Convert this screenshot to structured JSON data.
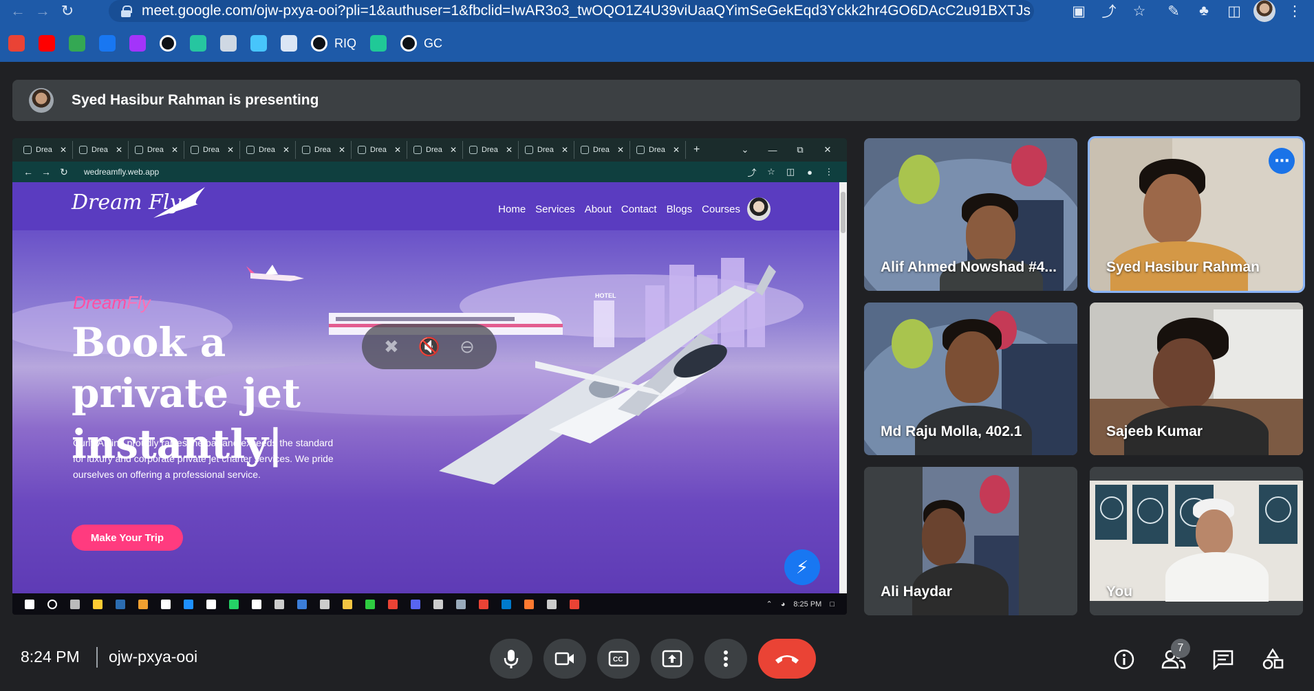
{
  "browser": {
    "url": "meet.google.com/ojw-pxya-ooi?pli=1&authuser=1&fbclid=IwAR3o3_twOQO1Z4U39viUaaQYimSeGekEqd3Yckk2hr4GO6DAcC2u91BXTJs",
    "bookmarks": [
      {
        "label": "",
        "icon": "gmail-icon",
        "color": "#ea4335"
      },
      {
        "label": "",
        "icon": "youtube-icon",
        "color": "#ff0000"
      },
      {
        "label": "",
        "icon": "maps-icon",
        "color": "#34a853"
      },
      {
        "label": "",
        "icon": "facebook-icon",
        "color": "#1877f2"
      },
      {
        "label": "",
        "icon": "messenger-icon",
        "color": "#a334fa"
      },
      {
        "label": "",
        "icon": "github-icon",
        "color": "#ffffff"
      },
      {
        "label": "",
        "icon": "replit-icon",
        "color": "#26c6a0"
      },
      {
        "label": "",
        "icon": "layers-icon",
        "color": "#cfd8e3"
      },
      {
        "label": "",
        "icon": "flutter-icon",
        "color": "#47c5fb"
      },
      {
        "label": "",
        "icon": "bike-icon",
        "color": "#dbe6f5"
      },
      {
        "label": "RIQ",
        "icon": "github-icon",
        "color": "#ffffff"
      },
      {
        "label": "",
        "icon": "diamond-icon",
        "color": "#20c997"
      },
      {
        "label": "GC",
        "icon": "github-icon",
        "color": "#ffffff"
      }
    ]
  },
  "banner": {
    "text": "Syed Hasibur Rahman is presenting"
  },
  "shared_screen": {
    "inner_tab_label": "Drea",
    "inner_tab_count": 12,
    "inner_url": "wedreamfly.web.app",
    "site": {
      "logo": "Dream Fly",
      "nav": [
        "Home",
        "Services",
        "About",
        "Contact",
        "Blogs",
        "Courses"
      ],
      "brand_dream": "Dream",
      "brand_fly": "Fly",
      "headline": "Book a private jet instantly|",
      "description": "Curly Airline proudly raises the bar and exceeds the standard for luxury and corporate private jet charter services. We pride ourselves on offering a professional service.",
      "cta": "Make Your Trip",
      "hotel_sign": "HOTEL"
    },
    "taskbar_time": "8:25 PM"
  },
  "participants": [
    {
      "name": "Alif Ahmed Nowshad #4..."
    },
    {
      "name": "Syed Hasibur Rahman",
      "active": true
    },
    {
      "name": "Md Raju Molla, 402.1"
    },
    {
      "name": "Sajeeb Kumar"
    },
    {
      "name": "Ali Haydar"
    },
    {
      "name": "You"
    }
  ],
  "bottom": {
    "time": "8:24 PM",
    "meeting_code": "ojw-pxya-ooi",
    "people_count": "7"
  },
  "colors": {
    "meet_bg": "#202124",
    "control_bg": "#3c4043",
    "end_call": "#ea4335",
    "active_speaker": "#8ab4f8",
    "browser_frame": "#1e5aa8",
    "cta_pink": "#ff3b7f"
  }
}
